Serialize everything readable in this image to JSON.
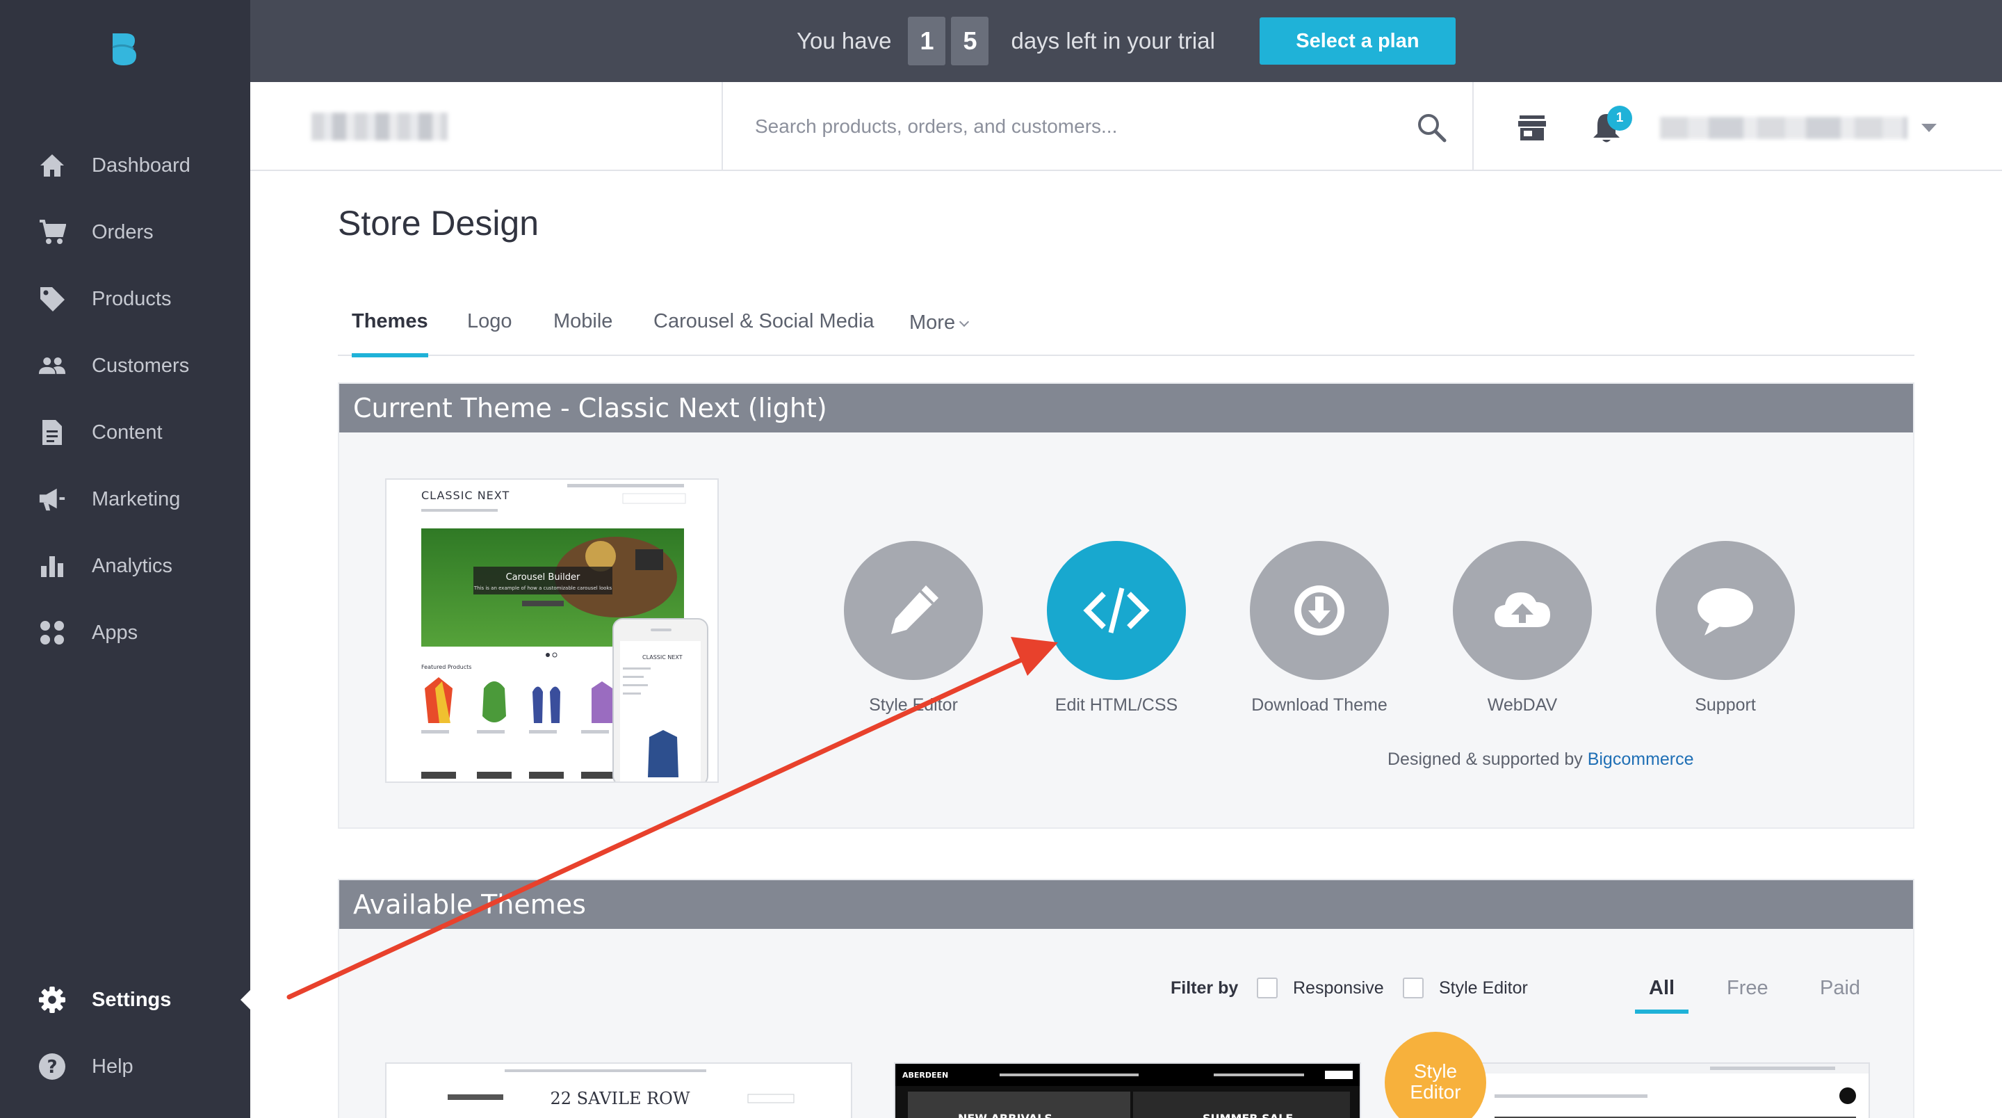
{
  "sidebar": {
    "items": [
      {
        "label": "Dashboard",
        "icon": "home-icon"
      },
      {
        "label": "Orders",
        "icon": "cart-icon"
      },
      {
        "label": "Products",
        "icon": "tag-icon"
      },
      {
        "label": "Customers",
        "icon": "people-icon"
      },
      {
        "label": "Content",
        "icon": "document-icon"
      },
      {
        "label": "Marketing",
        "icon": "megaphone-icon"
      },
      {
        "label": "Analytics",
        "icon": "bar-chart-icon"
      },
      {
        "label": "Apps",
        "icon": "apps-grid-icon"
      }
    ],
    "bottom_items": [
      {
        "label": "Settings",
        "icon": "gear-icon",
        "active": true
      },
      {
        "label": "Help",
        "icon": "help-icon"
      }
    ]
  },
  "trial": {
    "prefix": "You have",
    "digits": [
      "1",
      "5"
    ],
    "suffix": "days left in your trial",
    "cta": "Select a plan"
  },
  "header": {
    "search_placeholder": "Search products, orders, and customers...",
    "notification_count": "1"
  },
  "page": {
    "title": "Store Design",
    "tabs": [
      "Themes",
      "Logo",
      "Mobile",
      "Carousel & Social Media",
      "More"
    ],
    "active_tab": "Themes"
  },
  "current_theme": {
    "title": "Current Theme - Classic Next (light)",
    "preview": {
      "brand": "CLASSIC NEXT",
      "carousel_title": "Carousel Builder",
      "carousel_sub": "This is an example of how a customizable carousel looks",
      "featured": "Featured Products",
      "mobile_brand": "CLASSIC NEXT"
    },
    "actions": [
      {
        "label": "Style Editor",
        "icon": "pencil-icon"
      },
      {
        "label": "Edit HTML/CSS",
        "icon": "code-icon"
      },
      {
        "label": "Download Theme",
        "icon": "download-icon"
      },
      {
        "label": "WebDAV",
        "icon": "cloud-upload-icon"
      },
      {
        "label": "Support",
        "icon": "chat-bubble-icon"
      }
    ],
    "designed_by_prefix": "Designed & supported by",
    "designed_by_link": "Bigcommerce"
  },
  "available_themes": {
    "title": "Available Themes",
    "filter_label": "Filter by",
    "filters": [
      "Responsive",
      "Style Editor"
    ],
    "price_tabs": [
      "All",
      "Free",
      "Paid"
    ],
    "active_price_tab": "All",
    "thumbs": [
      {
        "name": "22 SAVILE ROW"
      },
      {
        "name": "ABERDEEN",
        "banner_left": "NEW ARRIVALS",
        "banner_right": "SUMMER SALE"
      }
    ],
    "badge_line1": "Style",
    "badge_line2": "Editor"
  },
  "colors": {
    "sidebar": "#313440",
    "accent": "#1fb2d8",
    "panel_header": "#828792",
    "annotation": "#e8412c"
  }
}
